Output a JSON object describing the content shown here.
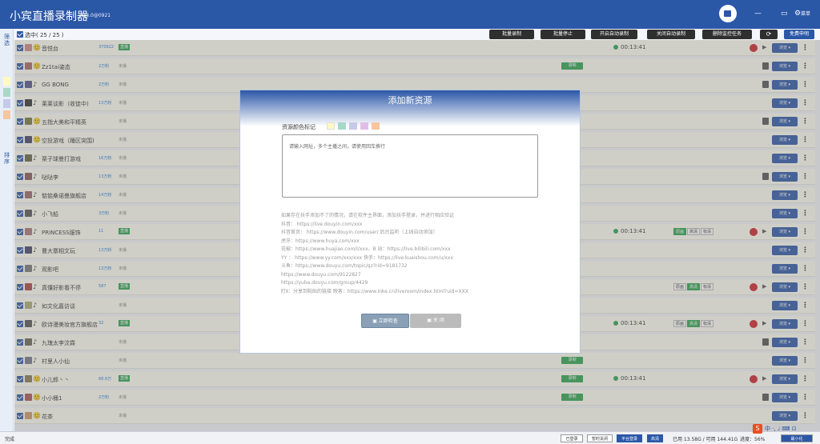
{
  "titlebar": {
    "title": "小宾直播录制器",
    "version": "v1.8.0@0921",
    "menu_label": "菜单",
    "folder_icon": "folder-icon",
    "settings_icon": "gear-icon"
  },
  "leftstrip": {
    "filter_label": "筛\n选",
    "sort_label": "排\n序",
    "colors": [
      "#fff9c4",
      "#a8d8c8",
      "#c5cae9",
      "#f7c59f"
    ]
  },
  "toolbar": {
    "select_label": "选中( 25 / 25 )",
    "buttons": [
      "批量录制",
      "批量停止",
      "开启自动录制",
      "关闭自动录制",
      "删除监控任务"
    ],
    "refresh_icon": "refresh-icon",
    "donate_label": "免费申明"
  },
  "rows": [
    {
      "name": "音悦台",
      "fans": "370922",
      "status": "直播",
      "live": true,
      "rec": false,
      "dur": "00:13:41",
      "quality": null,
      "stop": true,
      "plat": "🙂"
    },
    {
      "name": "Zz1tai姿态",
      "fans": "2万粉",
      "status": "未播",
      "live": false,
      "rec": true,
      "dur": null,
      "quality": null,
      "stop": false,
      "plat": "🙂"
    },
    {
      "name": "GG BONG",
      "fans": "2万粉",
      "status": "未播",
      "live": false,
      "rec": false,
      "dur": null,
      "quality": null,
      "stop": false,
      "plat": "♪"
    },
    {
      "name": "莱莱谈影（收徒中)",
      "fans": "13万粉",
      "status": "未播",
      "live": false,
      "rec": false,
      "dur": null,
      "quality": null,
      "stop": false,
      "plat": "♪"
    },
    {
      "name": "五指大美和平精英",
      "fans": "",
      "status": "未播",
      "live": false,
      "rec": false,
      "dur": null,
      "quality": null,
      "stop": false,
      "plat": "🙂"
    },
    {
      "name": "空投游戏（踊区突围)",
      "fans": "",
      "status": "未播",
      "live": false,
      "rec": false,
      "dur": null,
      "quality": null,
      "stop": false,
      "plat": "🙂"
    },
    {
      "name": "栗子球曼打游戏",
      "fans": "16万粉",
      "status": "未播",
      "live": false,
      "rec": false,
      "dur": null,
      "quality": null,
      "stop": false,
      "plat": "♪"
    },
    {
      "name": "哒哒李",
      "fans": "13万粉",
      "status": "未播",
      "live": false,
      "rec": false,
      "dur": null,
      "quality": null,
      "stop": false,
      "plat": "♪"
    },
    {
      "name": "惦惦桑诺曼旗舰店",
      "fans": "14万粉",
      "status": "未播",
      "live": false,
      "rec": false,
      "dur": null,
      "quality": null,
      "stop": false,
      "plat": "♪"
    },
    {
      "name": "小飞船",
      "fans": "3万粉",
      "status": "未播",
      "live": false,
      "rec": false,
      "dur": null,
      "quality": null,
      "stop": false,
      "plat": "♪"
    },
    {
      "name": "PRINCESS服饰",
      "fans": "11",
      "status": "直播",
      "live": true,
      "rec": false,
      "dur": "00:13:41",
      "quality": [
        "原画",
        "高清",
        "标清"
      ],
      "qon": 0,
      "stop": true,
      "plat": "♪"
    },
    {
      "name": "曹大寨相文玩",
      "fans": "13万粉",
      "status": "未播",
      "live": false,
      "rec": false,
      "dur": null,
      "quality": null,
      "stop": false,
      "plat": "♪"
    },
    {
      "name": "观影吧",
      "fans": "13万粉",
      "status": "未播",
      "live": false,
      "rec": false,
      "dur": null,
      "quality": null,
      "stop": false,
      "plat": "♪"
    },
    {
      "name": "真懂好影看不停",
      "fans": "587",
      "status": "直播",
      "live": true,
      "rec": false,
      "dur": null,
      "quality": [
        "原画",
        "高清",
        "标清"
      ],
      "qon": 1,
      "stop": true,
      "plat": "♪"
    },
    {
      "name": "如文化嘉访谈",
      "fans": "",
      "status": "未播",
      "live": false,
      "rec": false,
      "dur": null,
      "quality": null,
      "stop": false,
      "plat": "♪"
    },
    {
      "name": "欧诗漫美妆官方旗舰店",
      "fans": "32",
      "status": "直播",
      "live": true,
      "rec": false,
      "dur": "00:13:41",
      "quality": [
        "原画",
        "高清",
        "标清"
      ],
      "qon": 1,
      "stop": true,
      "plat": "♪"
    },
    {
      "name": "九瑰太李汶霖",
      "fans": "",
      "status": "未播",
      "live": false,
      "rec": false,
      "dur": null,
      "quality": null,
      "stop": false,
      "plat": "♪"
    },
    {
      "name": "村里人小仙",
      "fans": "",
      "status": "未播",
      "live": false,
      "rec": true,
      "dur": null,
      "quality": null,
      "stop": false,
      "plat": "♪"
    },
    {
      "name": "小儿郎丶丶",
      "fans": "68.6万",
      "status": "直播",
      "live": true,
      "rec": true,
      "dur": "00:13:41",
      "quality": null,
      "stop": true,
      "plat": "🙂"
    },
    {
      "name": "小小桶1",
      "fans": "2万粉",
      "status": "未播",
      "live": false,
      "rec": true,
      "dur": null,
      "quality": null,
      "stop": false,
      "plat": "🙂"
    },
    {
      "name": "花茶",
      "fans": "",
      "status": "未播",
      "live": false,
      "rec": false,
      "dur": null,
      "quality": null,
      "stop": false,
      "plat": "🙂"
    }
  ],
  "rec_label": "录制",
  "browse_label": "浏览 ▾",
  "modal": {
    "title": "添加新资源",
    "color_label": "资源颜色标记",
    "colors": [
      "#fff9c4",
      "#a8d8c8",
      "#c5cae9",
      "#e1bee7",
      "#f7c59f"
    ],
    "placeholder": "请输入网址，多个主播之间，请使用回车换行",
    "help": [
      "如果存在扶手添加不了的情况，请在软件主界面，添加扶手登录，并进行相应验证",
      "抖音：                https://live.douyin.com/xxx",
      "抖音首页：     https://www.douyin.com/user/  后台监听（上线自动添加）",
      "虎牙：https://www.huya.com/xxx",
      "花椒：https://www.huajiao.com/l/xxx，B 站：https://live.bilibili.com/xxx",
      "YY ：  https://www.yy.com/xxx/xxx    快手：https://live.kuaishou.com/u/xxx",
      "斗鱼：https://www.douyu.com/topic/qz?rid=9181732",
      "          https://www.douyu.com/9122827",
      "          https://yuba.douyu.com/group/4429",
      "  盯Ⅱ：分享到粘贴的链接    映客：https://www.inke.cn/liveroom/index.html?uid=XXX"
    ],
    "check_btn": "立即检查",
    "close_btn": "关 闭"
  },
  "statusbar": {
    "status": "完成",
    "btn1": "已登录",
    "btn2": "暂时关闭",
    "btn3": "平台登录",
    "btn4": "高清",
    "disk": "已用 13.58G / 可用 144.41G",
    "progress": "进度：56%",
    "ime": "中 ·, ♩ ⌨ ⊡"
  }
}
